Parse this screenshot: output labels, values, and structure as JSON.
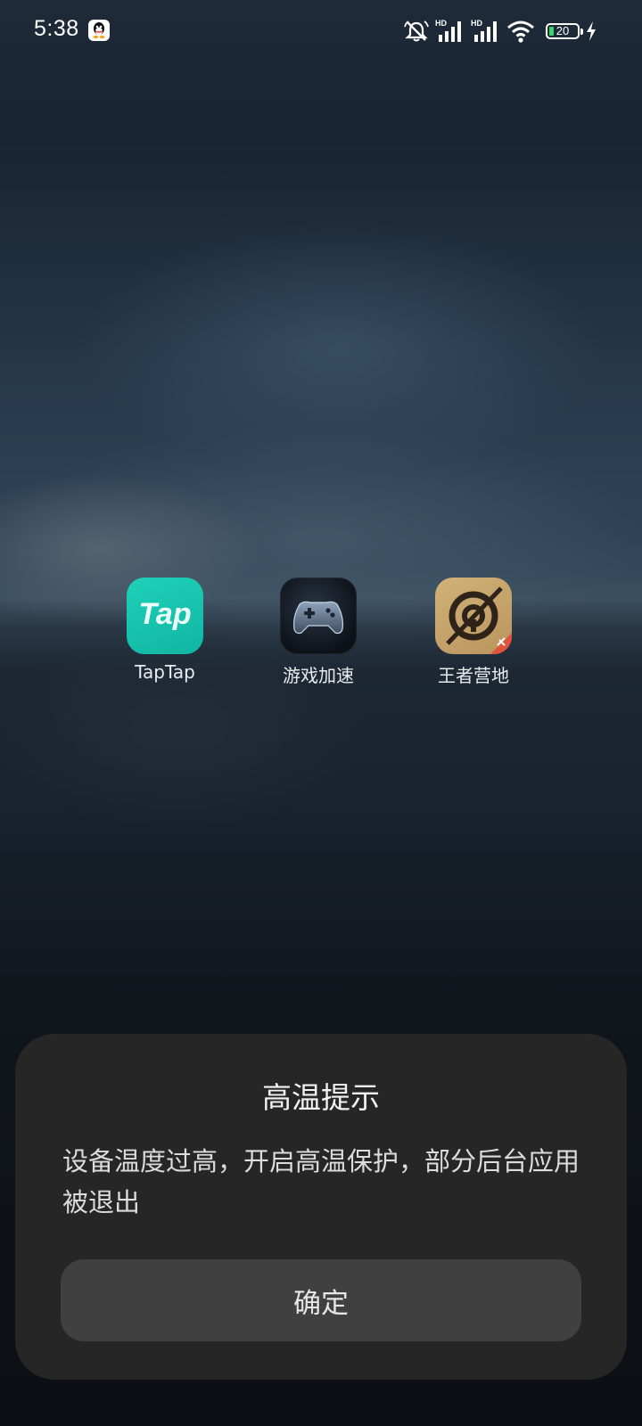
{
  "status_bar": {
    "time": "5:38",
    "notification_icon": "qq-icon",
    "icons": [
      "mute-icon",
      "signal-hd-1-icon",
      "signal-hd-2-icon",
      "wifi-icon",
      "battery-icon",
      "charging-icon"
    ],
    "signal_hd_label": "HD",
    "battery_level": "20",
    "battery_fill_color": "#38d66b"
  },
  "apps": [
    {
      "label": "TapTap",
      "icon": "taptap-icon",
      "icon_text": "Tap"
    },
    {
      "label": "游戏加速",
      "icon": "gamepad-icon"
    },
    {
      "label": "王者营地",
      "icon": "wangzhe-camp-icon"
    }
  ],
  "dialog": {
    "title": "高温提示",
    "message": "设备温度过高，开启高温保护，部分后台应用被退出",
    "confirm_label": "确定",
    "background_color": "#262626",
    "button_color": "#404040"
  }
}
